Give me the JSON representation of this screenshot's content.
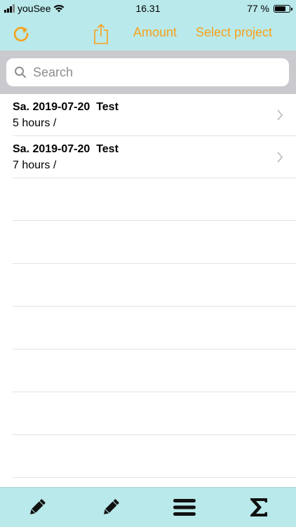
{
  "status_bar": {
    "carrier": "youSee",
    "time": "16.31",
    "battery": "77 %",
    "battery_level": 0.77
  },
  "toolbar": {
    "amount_label": "Amount",
    "select_project_label": "Select project",
    "refresh_icon": "refresh-icon",
    "share_icon": "share-icon"
  },
  "search": {
    "placeholder": "Search",
    "value": ""
  },
  "entries": [
    {
      "title": "Sa. 2019-07-20  Test",
      "subtitle": "5 hours /"
    },
    {
      "title": "Sa. 2019-07-20  Test",
      "subtitle": "7 hours /"
    }
  ],
  "tabbar": {
    "icons": [
      "pencil-icon",
      "pencil-icon",
      "menu-icon",
      "sigma-icon"
    ]
  },
  "colors": {
    "accent": "#f7a21b",
    "bar_background": "#b9e9ea",
    "search_background": "#c9c9ce"
  }
}
